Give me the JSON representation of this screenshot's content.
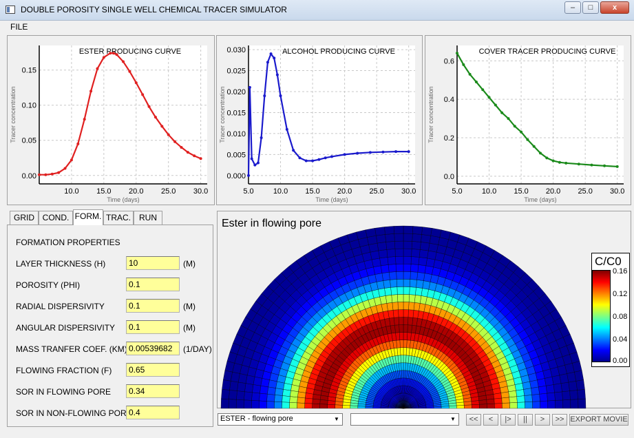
{
  "window": {
    "title": "DOUBLE POROSITY SINGLE WELL CHEMICAL TRACER SIMULATOR",
    "minimize": "–",
    "maximize": "□",
    "close": "x"
  },
  "menu": {
    "file": "FILE"
  },
  "charts": [
    {
      "type": "line",
      "title": "ESTER PRODUCING CURVE",
      "xlabel": "Time (days)",
      "ylabel": "Tracer concentration",
      "color": "#e02020",
      "xlim": [
        5,
        31
      ],
      "ylim": [
        -0.012,
        0.185
      ],
      "xticks": [
        "10.0",
        "15.0",
        "20.0",
        "25.0",
        "30.0"
      ],
      "yticks": [
        "0.00",
        "0.05",
        "0.10",
        "0.15"
      ],
      "x": [
        5,
        6,
        7,
        8,
        9,
        10,
        11,
        12,
        13,
        14,
        15,
        16,
        16.5,
        17,
        18,
        19,
        20,
        21,
        22,
        23,
        24,
        25,
        26,
        27,
        28,
        29,
        30
      ],
      "y": [
        0.001,
        0.001,
        0.002,
        0.004,
        0.01,
        0.022,
        0.045,
        0.08,
        0.12,
        0.152,
        0.168,
        0.174,
        0.174,
        0.172,
        0.162,
        0.148,
        0.132,
        0.115,
        0.098,
        0.083,
        0.07,
        0.058,
        0.048,
        0.04,
        0.033,
        0.028,
        0.024
      ]
    },
    {
      "type": "line",
      "title": "ALCOHOL PRODUCING CURVE",
      "xlabel": "Time (days)",
      "ylabel": "Tracer concentration",
      "color": "#1a1acc",
      "xlim": [
        5,
        31
      ],
      "ylim": [
        -0.002,
        0.031
      ],
      "xticks": [
        "5.0",
        "10.0",
        "15.0",
        "20.0",
        "25.0",
        "30.0"
      ],
      "yticks": [
        "0.000",
        "0.005",
        "0.010",
        "0.015",
        "0.020",
        "0.025",
        "0.030"
      ],
      "x": [
        5,
        5.2,
        5.5,
        6,
        6.5,
        7,
        7.5,
        8,
        8.5,
        9,
        9.5,
        10,
        11,
        12,
        13,
        14,
        15,
        16,
        17,
        18,
        20,
        22,
        24,
        26,
        28,
        30
      ],
      "y": [
        0.0,
        0.021,
        0.004,
        0.0025,
        0.003,
        0.009,
        0.019,
        0.027,
        0.029,
        0.028,
        0.024,
        0.019,
        0.011,
        0.006,
        0.0042,
        0.0035,
        0.0035,
        0.0038,
        0.0042,
        0.0045,
        0.005,
        0.0053,
        0.0055,
        0.0056,
        0.0057,
        0.0057
      ]
    },
    {
      "type": "line",
      "title": "COVER TRACER PRODUCING CURVE",
      "xlabel": "Time (days)",
      "ylabel": "Tracer concentration",
      "color": "#1a8a1a",
      "xlim": [
        5,
        31
      ],
      "ylim": [
        -0.04,
        0.68
      ],
      "xticks": [
        "5.0",
        "10.0",
        "15.0",
        "20.0",
        "25.0",
        "30.0"
      ],
      "yticks": [
        "0.0",
        "0.2",
        "0.4",
        "0.6"
      ],
      "x": [
        5,
        6,
        7,
        8,
        9,
        10,
        11,
        12,
        13,
        14,
        15,
        16,
        17,
        18,
        19,
        20,
        21,
        22,
        24,
        26,
        28,
        30
      ],
      "y": [
        0.64,
        0.58,
        0.53,
        0.49,
        0.45,
        0.41,
        0.37,
        0.33,
        0.3,
        0.26,
        0.23,
        0.19,
        0.155,
        0.12,
        0.095,
        0.08,
        0.072,
        0.068,
        0.063,
        0.058,
        0.054,
        0.05
      ]
    }
  ],
  "tabs": [
    "GRID",
    "COND.",
    "FORM.",
    "TRAC.",
    "RUN"
  ],
  "active_tab": "FORM.",
  "formation": {
    "section_title": "FORMATION PROPERTIES",
    "rows": [
      {
        "label": "LAYER THICKNESS (H)",
        "value": "10",
        "unit": "(M)"
      },
      {
        "label": "POROSITY (PHI)",
        "value": "0.1",
        "unit": ""
      },
      {
        "label": "RADIAL DISPERSIVITY",
        "value": "0.1",
        "unit": "(M)"
      },
      {
        "label": "ANGULAR DISPERSIVITY",
        "value": "0.1",
        "unit": "(M)"
      },
      {
        "label": "MASS TRANFER COEF. (KM)",
        "value": "0.00539682",
        "unit": "(1/DAY)"
      },
      {
        "label": "FLOWING FRACTION (F)",
        "value": "0.65",
        "unit": ""
      },
      {
        "label": "SOR IN FLOWING PORE",
        "value": "0.34",
        "unit": ""
      },
      {
        "label": "SOR IN NON-FLOWING PORE",
        "value": "0.4",
        "unit": ""
      }
    ]
  },
  "plot": {
    "title": "Ester in flowing pore",
    "colorbar_title": "C/C0",
    "colorbar_ticks": [
      "0.16",
      "0.12",
      "0.08",
      "0.04",
      "0.00"
    ],
    "colorbar_min": 0,
    "colorbar_max": 0.16
  },
  "controls": {
    "select1_value": "ESTER - flowing pore",
    "select2_value": "",
    "buttons": [
      "<<",
      "<",
      "|>",
      "||",
      ">",
      ">>"
    ],
    "export": "EXPORT MOVIE"
  }
}
